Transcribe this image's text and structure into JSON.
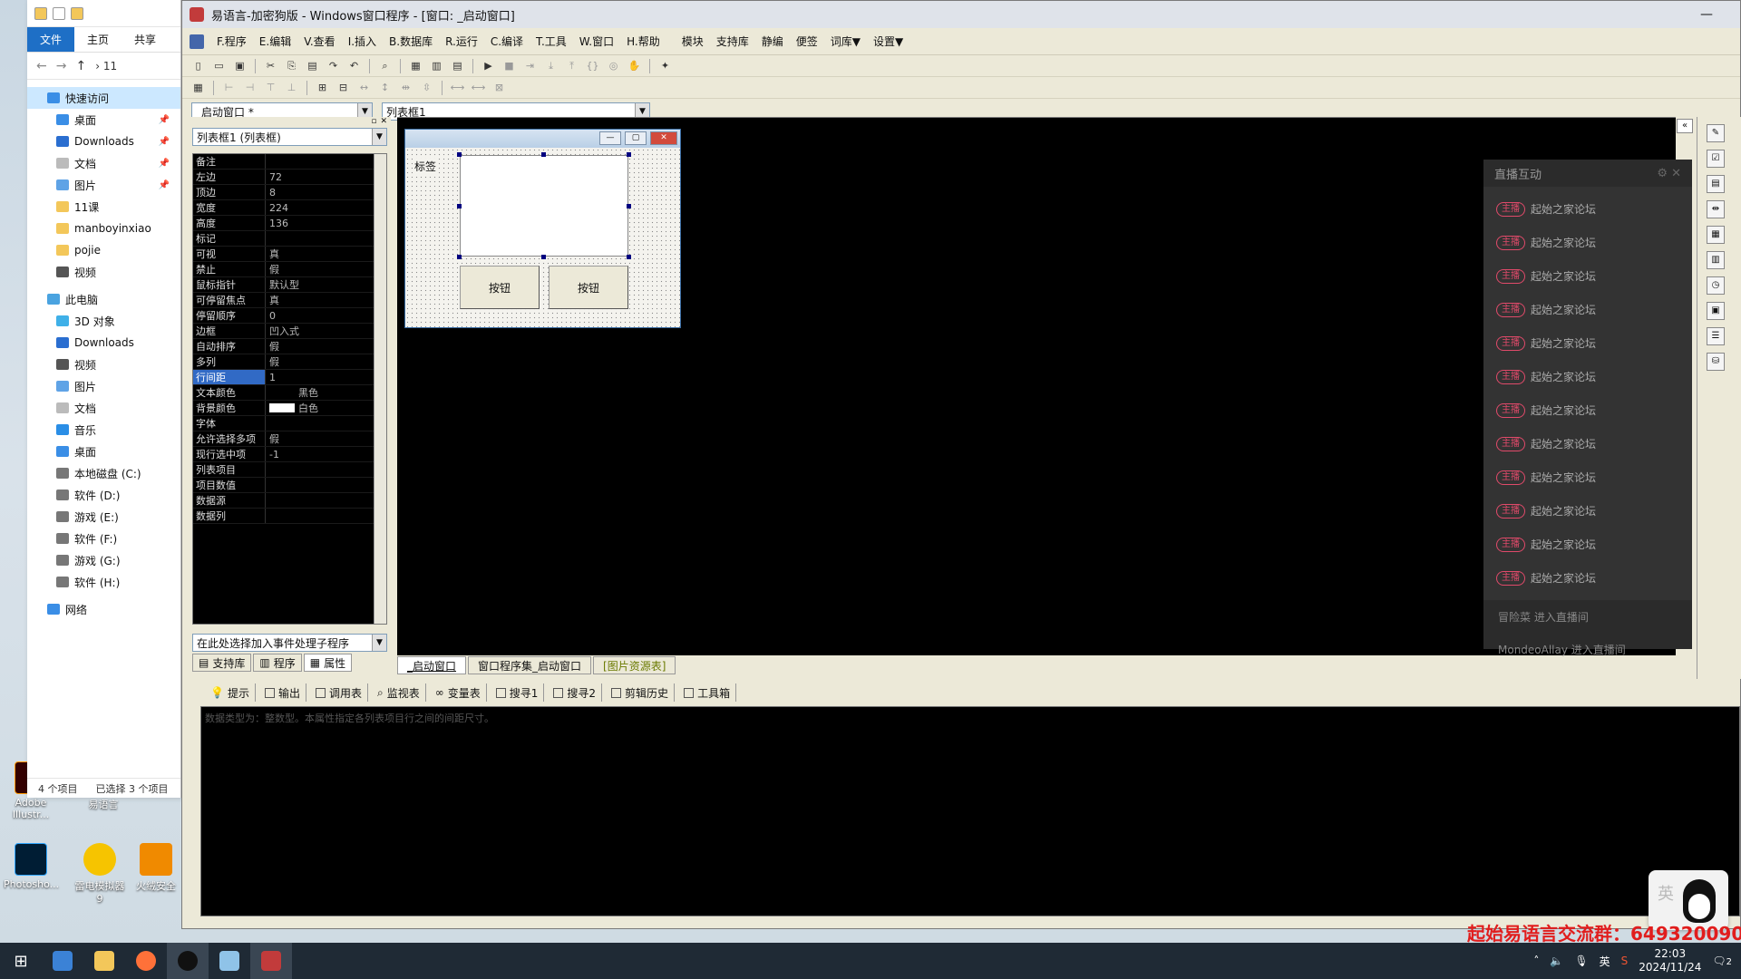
{
  "ide": {
    "title": "易语言-加密狗版 - Windows窗口程序 - [窗口: _启动窗口]",
    "menus": [
      "F.程序",
      "E.编辑",
      "V.查看",
      "I.插入",
      "B.数据库",
      "R.运行",
      "C.编译",
      "T.工具",
      "W.窗口",
      "H.帮助",
      "模块",
      "支持库",
      "静编",
      "便签",
      "词库▼",
      "设置▼"
    ],
    "window_combo": "_启动窗口 *",
    "control_combo": "列表框1",
    "prop_combo": "列表框1 (列表框)",
    "event_combo": "在此处选择加入事件处理子程序"
  },
  "properties": [
    {
      "k": "备注",
      "v": ""
    },
    {
      "k": "左边",
      "v": "72"
    },
    {
      "k": "顶边",
      "v": "8"
    },
    {
      "k": "宽度",
      "v": "224"
    },
    {
      "k": "高度",
      "v": "136"
    },
    {
      "k": "标记",
      "v": ""
    },
    {
      "k": "可视",
      "v": "真"
    },
    {
      "k": "禁止",
      "v": "假"
    },
    {
      "k": "鼠标指针",
      "v": "默认型"
    },
    {
      "k": "可停留焦点",
      "v": "真"
    },
    {
      "k": "  停留顺序",
      "v": "0"
    },
    {
      "k": "边框",
      "v": "凹入式"
    },
    {
      "k": "自动排序",
      "v": "假"
    },
    {
      "k": "多列",
      "v": "假"
    },
    {
      "k": "行间距",
      "v": "1"
    },
    {
      "k": "文本颜色",
      "v": "黑色",
      "swatch": "#000000"
    },
    {
      "k": "背景颜色",
      "v": "白色",
      "swatch": "#ffffff"
    },
    {
      "k": "字体",
      "v": ""
    },
    {
      "k": "允许选择多项",
      "v": "假"
    },
    {
      "k": "现行选中项",
      "v": "-1"
    },
    {
      "k": "列表项目",
      "v": ""
    },
    {
      "k": "项目数值",
      "v": ""
    },
    {
      "k": "数据源",
      "v": ""
    },
    {
      "k": "数据列",
      "v": ""
    }
  ],
  "panel_tabs": [
    "支持库",
    "程序",
    "属性"
  ],
  "form": {
    "label": "标签",
    "button1": "按钮",
    "button2": "按钮"
  },
  "design_tabs": [
    "_启动窗口",
    "窗口程序集_启动窗口",
    "[图片资源表]"
  ],
  "output_tabs": [
    "提示",
    "输出",
    "调用表",
    "监视表",
    "变量表",
    "搜寻1",
    "搜寻2",
    "剪辑历史",
    "工具箱"
  ],
  "output_text": "数据类型为：整数型。本属性指定各列表项目行之间的间距尺寸。",
  "explorer": {
    "tabs": [
      "文件",
      "主页",
      "共享"
    ],
    "path_tail": "11",
    "quick_access": "快速访问",
    "quick_items": [
      "桌面",
      "Downloads",
      "文档",
      "图片",
      "11课",
      "manboyinxiao",
      "pojie",
      "视频"
    ],
    "this_pc": "此电脑",
    "pc_items": [
      "3D 对象",
      "Downloads",
      "视频",
      "图片",
      "文档",
      "音乐",
      "桌面",
      "本地磁盘 (C:)",
      "软件 (D:)",
      "游戏 (E:)",
      "软件 (F:)",
      "游戏 (G:)",
      "软件 (H:)"
    ],
    "network": "网络",
    "status_count": "4 个项目",
    "status_selected": "已选择 3 个项目"
  },
  "live": {
    "title": "直播互动",
    "badge": "主播",
    "messages": [
      "起始之家论坛",
      "起始之家论坛",
      "起始之家论坛",
      "起始之家论坛",
      "起始之家论坛",
      "起始之家论坛",
      "起始之家论坛",
      "起始之家论坛",
      "起始之家论坛",
      "起始之家论坛",
      "起始之家论坛",
      "起始之家论坛"
    ],
    "join1": "冒险菜 进入直播间",
    "join2": "MondeoAllay 进入直播间"
  },
  "desktop_icons": [
    "Adobe Illustr...",
    "易语言",
    "Photosho...",
    "雷电模拟器9",
    "火绒安全"
  ],
  "promo": "起始易语言交流群：649320090",
  "ime_label": "英",
  "taskbar": {
    "time": "22:03",
    "date": "2024/11/24",
    "ime": "英",
    "notify": "2"
  }
}
